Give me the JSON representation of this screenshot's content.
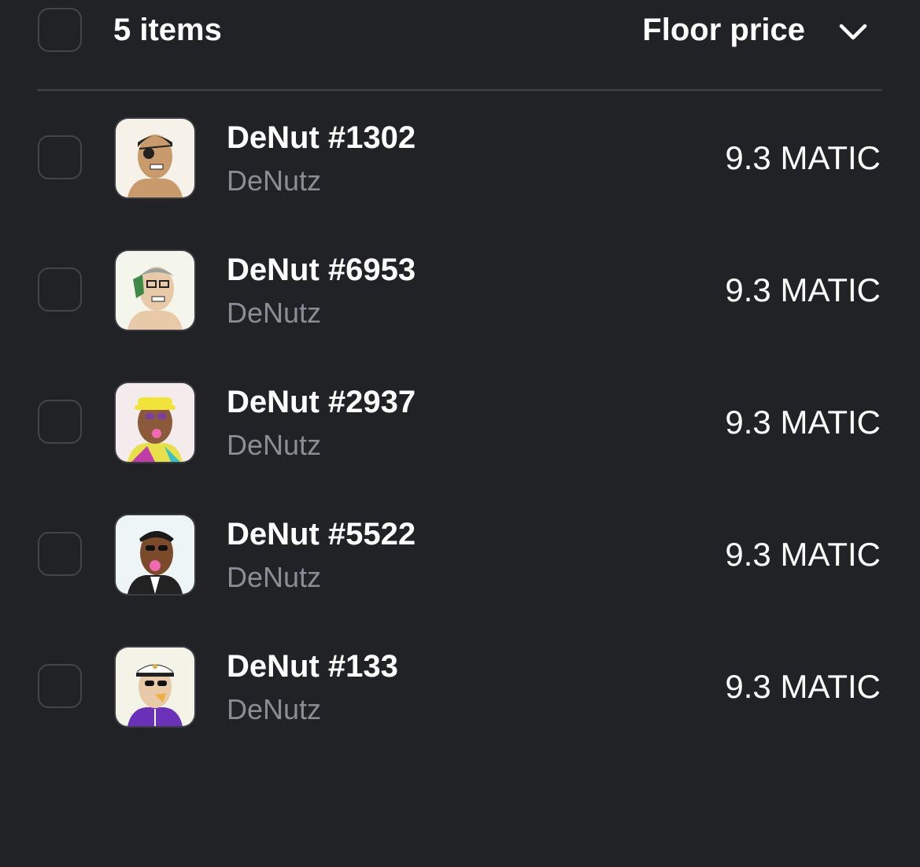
{
  "header": {
    "count_label": "5 items",
    "sort_label": "Floor price",
    "sort_icon": "chevron-down-icon"
  },
  "items": [
    {
      "name": "DeNut #1302",
      "collection": "DeNutz",
      "price": "9.3 MATIC",
      "bg": "#f6f2ea"
    },
    {
      "name": "DeNut #6953",
      "collection": "DeNutz",
      "price": "9.3 MATIC",
      "bg": "#f4f6ec"
    },
    {
      "name": "DeNut #2937",
      "collection": "DeNutz",
      "price": "9.3 MATIC",
      "bg": "#f4ecec"
    },
    {
      "name": "DeNut #5522",
      "collection": "DeNutz",
      "price": "9.3 MATIC",
      "bg": "#eef5f7"
    },
    {
      "name": "DeNut #133",
      "collection": "DeNutz",
      "price": "9.3 MATIC",
      "bg": "#f4f3e8"
    }
  ],
  "colors": {
    "background": "#212226",
    "border": "#43454b",
    "muted_text": "#8a8d94"
  }
}
